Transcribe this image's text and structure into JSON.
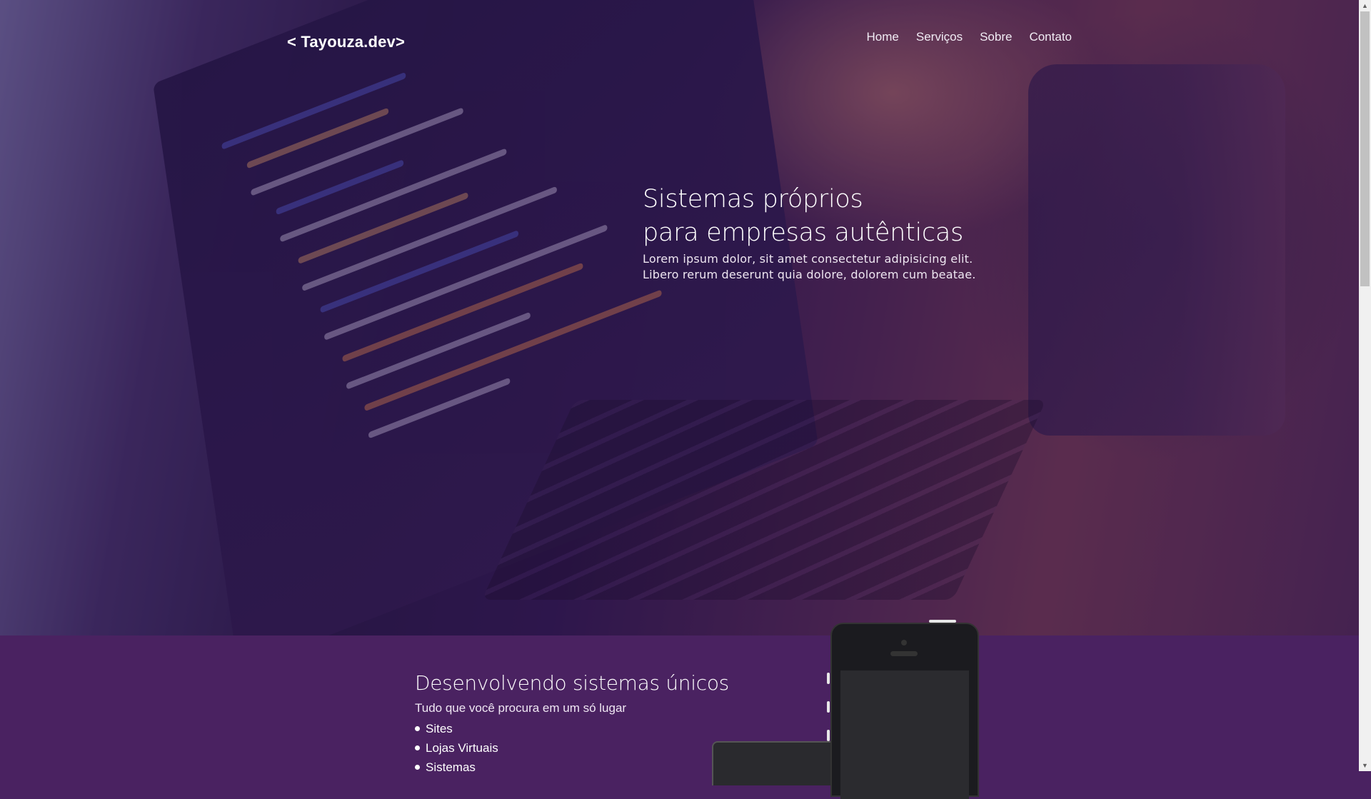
{
  "header": {
    "logo": "< Tayouza.dev>",
    "nav": [
      {
        "label": "Home"
      },
      {
        "label": "Serviços"
      },
      {
        "label": "Sobre"
      },
      {
        "label": "Contato"
      }
    ]
  },
  "hero": {
    "title_line1": "Sistemas próprios",
    "title_line2": "para empresas autênticas",
    "subtitle_line1": "Lorem ipsum dolor, sit amet consectetur adipisicing elit.",
    "subtitle_line2": "Libero rerum deserunt quia dolore, dolorem cum beatae."
  },
  "services": {
    "title": "Desenvolvendo sistemas únicos",
    "subtitle": "Tudo que você procura em um só lugar",
    "items": [
      {
        "label": "Sites"
      },
      {
        "label": "Lojas Virtuais"
      },
      {
        "label": "Sistemas"
      }
    ]
  },
  "scrollbar": {
    "up_icon": "arrow-up-icon",
    "down_icon": "arrow-down-icon",
    "position": 0
  }
}
